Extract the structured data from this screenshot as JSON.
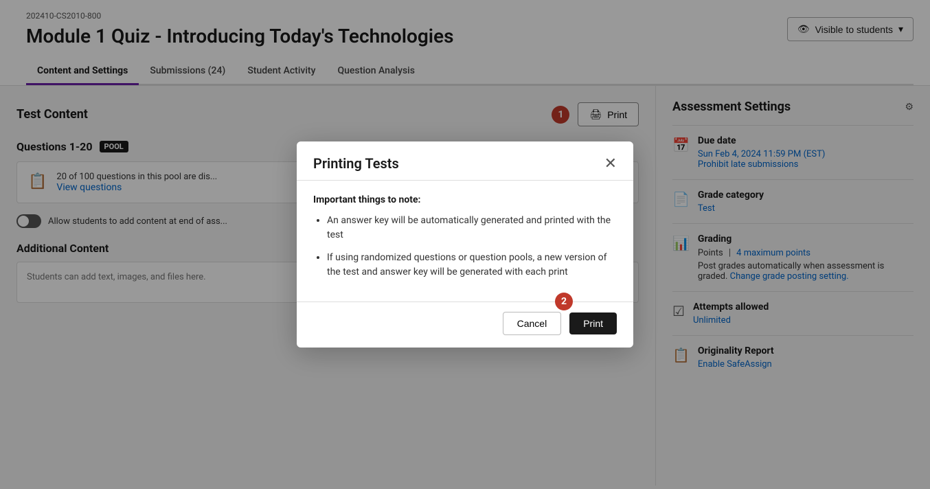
{
  "header": {
    "breadcrumb": "202410-CS2010-800",
    "title": "Module 1 Quiz - Introducing Today's Technologies",
    "visible_btn_label": "Visible to students"
  },
  "tabs": [
    {
      "id": "content-settings",
      "label": "Content and Settings",
      "active": true
    },
    {
      "id": "submissions",
      "label": "Submissions (24)",
      "active": false
    },
    {
      "id": "student-activity",
      "label": "Student Activity",
      "active": false
    },
    {
      "id": "question-analysis",
      "label": "Question Analysis",
      "active": false
    }
  ],
  "main": {
    "test_content_title": "Test Content",
    "print_button_label": "Print",
    "questions_label": "Questions 1-20",
    "pool_badge": "POOL",
    "pool_info_text": "20 of 100 questions in this pool are dis...",
    "view_questions_link": "View questions",
    "toggle_label": "Allow students to add content at end of ass...",
    "additional_content_title": "Additional Content",
    "additional_content_placeholder": "Students can add text, images, and files here."
  },
  "sidebar": {
    "title": "Assessment Settings",
    "due_date_label": "Due date",
    "due_date_value": "Sun Feb 4, 2024 11:59 PM (EST)",
    "prohibit_late_label": "Prohibit late submissions",
    "grade_category_label": "Grade category",
    "grade_category_value": "Test",
    "grading_label": "Grading",
    "grading_points": "Points",
    "grading_max_link": "4 maximum points",
    "grading_auto_text": "Post grades automatically when assessment is graded.",
    "change_grade_link": "Change grade posting setting.",
    "attempts_label": "Attempts allowed",
    "attempts_value": "Unlimited",
    "originality_label": "Originality Report",
    "originality_link": "Enable SafeAssign"
  },
  "modal": {
    "title": "Printing Tests",
    "note_label": "Important things to note:",
    "bullet_1": "An answer key will be automatically generated and printed with the test",
    "bullet_2": "If using randomized questions or question pools, a new version of the test and answer key will be generated with each print",
    "cancel_label": "Cancel",
    "print_label": "Print",
    "step_1": "1",
    "step_2": "2"
  },
  "icons": {
    "eye": "👁",
    "chevron_down": "▾",
    "printer": "🖨",
    "calendar": "📅",
    "grade_doc": "📄",
    "grading_icon": "📊",
    "attempts_icon": "☑",
    "originality_icon": "📋",
    "pool_icon": "📋",
    "gear": "⚙",
    "close": "✕"
  }
}
